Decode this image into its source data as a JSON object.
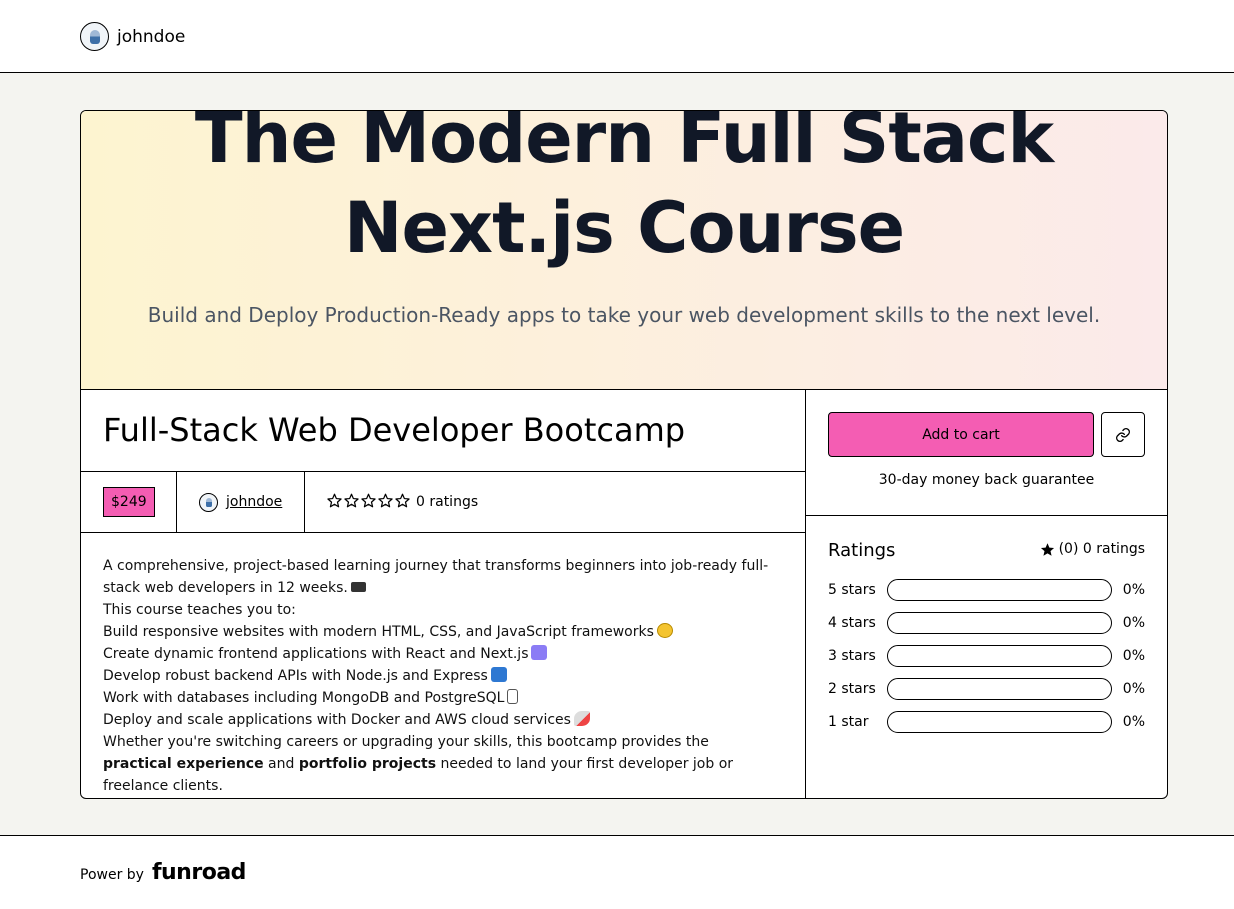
{
  "header": {
    "username": "johndoe"
  },
  "hero": {
    "title": "The Modern Full Stack Next.js Course",
    "subtitle": "Build and Deploy Production-Ready apps to take your web development skills to the next level."
  },
  "product": {
    "title": "Full-Stack Web Developer Bootcamp",
    "price": "$249",
    "author": "johndoe",
    "rating_stars": 0,
    "rating_text": "0 ratings",
    "description": {
      "intro": "A comprehensive, project-based learning journey that transforms beginners into job-ready full-stack web developers in 12 weeks.",
      "teaches": "This course teaches you to:",
      "items": [
        "Build responsive websites with modern HTML, CSS, and JavaScript frameworks",
        "Create dynamic frontend applications with React and Next.js",
        "Develop robust backend APIs with Node.js and Express",
        "Work with databases including MongoDB and PostgreSQL",
        "Deploy and scale applications with Docker and AWS cloud services"
      ],
      "closing_1": "Whether you're switching careers or upgrading your skills, this bootcamp provides the ",
      "closing_bold_1": "practical experience",
      "closing_2": " and ",
      "closing_bold_2": "portfolio projects",
      "closing_3": " needed to land your first developer job or freelance clients."
    }
  },
  "purchase": {
    "add_to_cart": "Add to cart",
    "guarantee": "30-day money back guarantee"
  },
  "ratings": {
    "heading": "Ratings",
    "summary": "(0) 0 ratings",
    "rows": [
      {
        "label": "5 stars",
        "percent": "0%",
        "value": 0
      },
      {
        "label": "4 stars",
        "percent": "0%",
        "value": 0
      },
      {
        "label": "3 stars",
        "percent": "0%",
        "value": 0
      },
      {
        "label": "2 stars",
        "percent": "0%",
        "value": 0
      },
      {
        "label": "1 star",
        "percent": "0%",
        "value": 0
      }
    ]
  },
  "footer": {
    "power_by": "Power by",
    "brand": "funroad"
  },
  "colors": {
    "accent": "#f45db3",
    "page_bg": "#f4f4f0"
  },
  "icons": [
    "avatar",
    "star-outline-icon",
    "star-filled-icon",
    "link-icon"
  ]
}
